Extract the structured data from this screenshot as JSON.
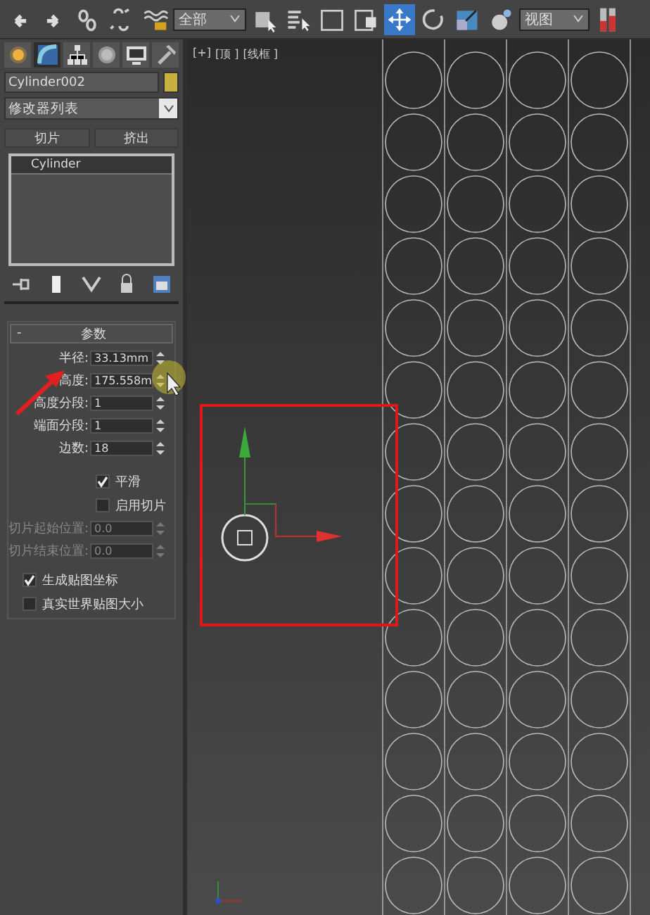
{
  "toolbar": {
    "tools": [
      {
        "kind": "undo",
        "selected": false
      },
      {
        "kind": "redo",
        "selected": false
      },
      {
        "kind": "link",
        "selected": false
      },
      {
        "kind": "unlink",
        "selected": false
      },
      {
        "kind": "bind",
        "selected": false
      },
      {
        "kind": "filter"
      },
      {
        "kind": "select",
        "selected": false
      },
      {
        "kind": "select-by-name",
        "selected": false
      },
      {
        "kind": "region",
        "selected": false
      },
      {
        "kind": "crossing",
        "selected": false
      },
      {
        "kind": "move",
        "selected": true
      },
      {
        "kind": "rotate",
        "selected": false
      },
      {
        "kind": "scale",
        "selected": false
      },
      {
        "kind": "manipulate",
        "selected": false
      },
      {
        "kind": "coords"
      },
      {
        "kind": "pivot",
        "selected": false
      }
    ],
    "selection_filter": "全部",
    "reference_coordinate": "视图"
  },
  "command_panel": {
    "tabs": [
      {
        "kind": "create",
        "selected": false
      },
      {
        "kind": "modify",
        "selected": true
      },
      {
        "kind": "hierarchy",
        "selected": false
      },
      {
        "kind": "motion",
        "selected": false
      },
      {
        "kind": "display",
        "selected": false
      },
      {
        "kind": "utilities",
        "selected": false
      }
    ],
    "object_name": "Cylinder002",
    "modifier_list": "修改器列表",
    "modifier_buttons": [
      "切片",
      "挤出"
    ],
    "modifier_stack": [
      {
        "label": "Cylinder",
        "selected": true
      }
    ],
    "rollout": {
      "expander": "-",
      "title": "参数",
      "fields": [
        {
          "label": "半径:",
          "value": "33.13mm",
          "disabled": false
        },
        {
          "label": "高度:",
          "value": "175.558m",
          "disabled": false
        },
        {
          "label": "高度分段:",
          "value": "1",
          "disabled": false
        },
        {
          "label": "端面分段:",
          "value": "1",
          "disabled": false
        },
        {
          "label": "边数:",
          "value": "18",
          "disabled": false
        }
      ],
      "options": [
        {
          "kind": "checkbox",
          "label": "平滑",
          "checked": true
        },
        {
          "kind": "checkbox",
          "label": "启用切片",
          "checked": false
        },
        {
          "kind": "field",
          "label": "切片起始位置:",
          "value": "0.0",
          "disabled": true
        },
        {
          "kind": "field",
          "label": "切片结束位置:",
          "value": "0.0",
          "disabled": true
        },
        {
          "kind": "checkbox-left",
          "label": "生成贴图坐标",
          "checked": true
        },
        {
          "kind": "checkbox-left",
          "label": "真实世界贴图大小",
          "checked": false
        }
      ]
    }
  },
  "viewport": {
    "labels": [
      "[+]",
      "[顶 ]",
      "[线框 ]"
    ]
  }
}
